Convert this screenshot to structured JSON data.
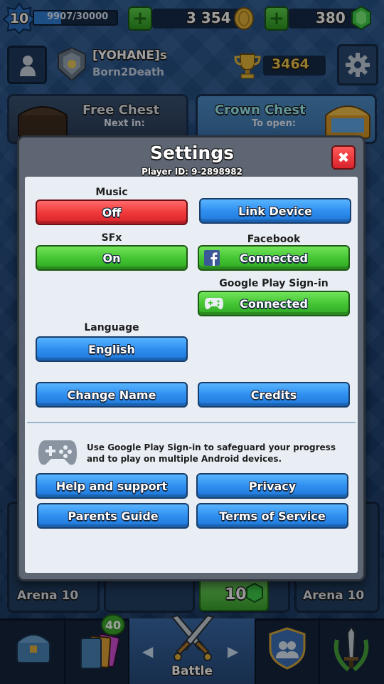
{
  "hud": {
    "level": "10",
    "xp_text": "9907/30000",
    "xp_fraction": 0.33,
    "gold": "3 354",
    "gems": "380"
  },
  "profile": {
    "player_name": "[YOHANE]s",
    "clan_name": "Born2Death",
    "trophies": "3464"
  },
  "chests": {
    "free_title": "Free Chest",
    "free_sub": "Next in:",
    "crown_title": "Crown Chest",
    "crown_sub": "To open:"
  },
  "background": {
    "arena_left": "Arena 10",
    "arena_right": "Arena 10",
    "card_value": "10",
    "nav_badge": "40",
    "nav_battle": "Battle"
  },
  "settings": {
    "title": "Settings",
    "player_id": "Player ID: 9-2898982",
    "music_label": "Music",
    "music_value": "Off",
    "link_device": "Link Device",
    "sfx_label": "SFx",
    "sfx_value": "On",
    "facebook_label": "Facebook",
    "facebook_value": "Connected",
    "google_label": "Google Play Sign-in",
    "google_value": "Connected",
    "language_label": "Language",
    "language_value": "English",
    "change_name": "Change Name",
    "credits": "Credits",
    "google_info": "Use Google Play Sign-in to safeguard your progress and to play on multiple Android devices.",
    "help": "Help and support",
    "privacy": "Privacy",
    "parents": "Parents Guide",
    "terms": "Terms of Service"
  },
  "colors": {
    "blue_button": "#2f8ff0",
    "red_button": "#f03a3a",
    "green_button": "#45c634",
    "panel": "#e8eef4"
  },
  "icons": {
    "close": "close-x-icon",
    "facebook": "facebook-icon",
    "gamepad": "gamepad-icon",
    "gear": "gear-icon",
    "trophy": "trophy-icon",
    "gold": "gold-coin-icon",
    "gem": "gem-icon"
  }
}
